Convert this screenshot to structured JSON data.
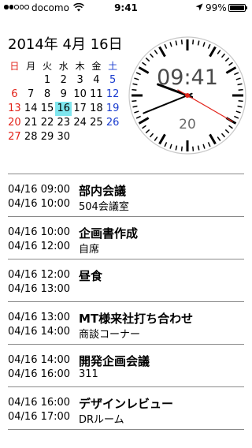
{
  "status": {
    "carrier": "docomo",
    "time": "9:41",
    "battery": "99%",
    "battery_level": 0.99,
    "signal_bars": 2,
    "signal_total": 5
  },
  "date_header": "2014年 4月 16日",
  "calendar": {
    "weekdays": [
      "日",
      "月",
      "火",
      "水",
      "木",
      "金",
      "土"
    ],
    "weeks": [
      [
        "",
        "",
        "1",
        "2",
        "3",
        "4",
        "5"
      ],
      [
        "6",
        "7",
        "8",
        "9",
        "10",
        "11",
        "12"
      ],
      [
        "13",
        "14",
        "15",
        "16",
        "17",
        "18",
        "19"
      ],
      [
        "20",
        "21",
        "22",
        "23",
        "24",
        "25",
        "26"
      ],
      [
        "27",
        "28",
        "29",
        "30",
        "",
        "",
        ""
      ]
    ],
    "today": "16",
    "colors": {
      "sunday": "#e2231a",
      "saturday": "#1a3ccf",
      "today_bg": "#7fe6ee"
    }
  },
  "clock": {
    "digital": "09:41",
    "day": "20",
    "hour": 9,
    "minute": 41,
    "second": 20,
    "second_hand_color": "#e2231a"
  },
  "events": [
    {
      "start": "04/16 09:00",
      "end": "04/16 10:00",
      "title": "部内会議",
      "location": "504会議室"
    },
    {
      "start": "04/16 10:00",
      "end": "04/16 12:00",
      "title": "企画書作成",
      "location": "自席"
    },
    {
      "start": "04/16 12:00",
      "end": "04/16 13:00",
      "title": "昼食",
      "location": ""
    },
    {
      "start": "04/16 13:00",
      "end": "04/16 14:00",
      "title": "MT様来社打ち合わせ",
      "location": "商談コーナー"
    },
    {
      "start": "04/16 14:00",
      "end": "04/16 16:00",
      "title": "開発企画会議",
      "location": "311"
    },
    {
      "start": "04/16 16:00",
      "end": "04/16 17:00",
      "title": "デザインレビュー",
      "location": "DRルーム"
    }
  ]
}
